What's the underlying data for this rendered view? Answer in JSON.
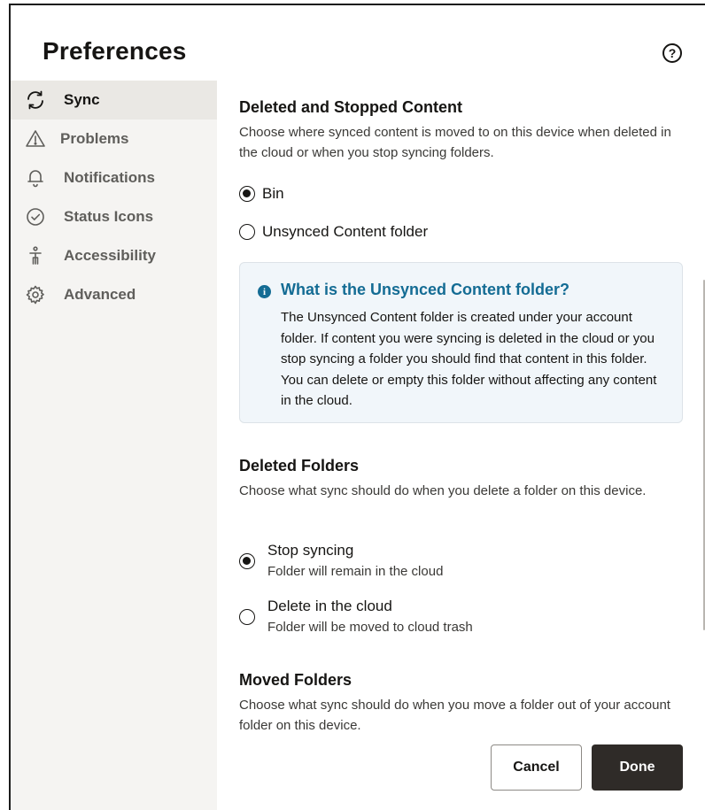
{
  "window": {
    "title": "Preferences",
    "help_icon": "help-circle-icon",
    "help_glyph": "?"
  },
  "sidebar": {
    "items": [
      {
        "label": "Sync",
        "icon": "sync-icon",
        "active": true
      },
      {
        "label": "Problems",
        "icon": "warning-icon",
        "active": false
      },
      {
        "label": "Notifications",
        "icon": "bell-icon",
        "active": false
      },
      {
        "label": "Status Icons",
        "icon": "check-circle-icon",
        "active": false
      },
      {
        "label": "Accessibility",
        "icon": "accessibility-icon",
        "active": false
      },
      {
        "label": "Advanced",
        "icon": "gear-icon",
        "active": false
      }
    ]
  },
  "deleted_stopped": {
    "heading": "Deleted and Stopped Content",
    "description": "Choose where synced content is moved to on this device when deleted in the cloud or when you stop syncing folders.",
    "options": [
      {
        "label": "Bin",
        "selected": true
      },
      {
        "label": "Unsynced Content folder",
        "selected": false
      }
    ],
    "info": {
      "icon": "info-icon",
      "glyph": "i",
      "title": "What is the Unsynced Content folder?",
      "body": "The Unsynced Content folder is created under your account folder. If content you were syncing is deleted in the cloud or you stop syncing a folder you should find that content in this folder. You can delete or empty this folder without affecting any content in the cloud."
    }
  },
  "deleted_folders": {
    "heading": "Deleted Folders",
    "description": "Choose what sync should do when you delete a folder on this device.",
    "options": [
      {
        "label": "Stop syncing",
        "sublabel": "Folder will remain in the cloud",
        "selected": true
      },
      {
        "label": "Delete in the cloud",
        "sublabel": "Folder will be moved to cloud trash",
        "selected": false
      }
    ]
  },
  "moved_folders": {
    "heading": "Moved Folders",
    "description": "Choose what sync should do when you move a folder out of your account folder on this device."
  },
  "footer": {
    "cancel_label": "Cancel",
    "done_label": "Done"
  },
  "colors": {
    "accent": "#146c94",
    "primary_button": "#2f2b28",
    "sidebar_bg": "#f5f4f2",
    "sidebar_active": "#eae8e4",
    "info_bg": "#f1f6fa"
  }
}
